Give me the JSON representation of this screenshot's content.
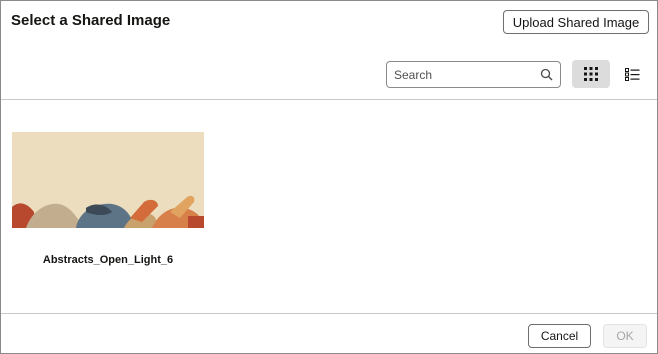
{
  "dialog": {
    "title": "Select a Shared Image",
    "upload_label": "Upload Shared Image"
  },
  "toolbar": {
    "search_placeholder": "Search",
    "search_value": "",
    "search_icon": "search-icon",
    "grid_view_icon": "grid-view-icon",
    "list_view_icon": "list-view-icon",
    "active_view": "grid"
  },
  "images": [
    {
      "name": "Abstracts_Open_Light_6"
    }
  ],
  "footer": {
    "cancel_label": "Cancel",
    "ok_label": "OK"
  },
  "colors": {
    "grid_view_active_bg": "#dcdcdc",
    "thumbnail_background": "#ede0c2"
  }
}
